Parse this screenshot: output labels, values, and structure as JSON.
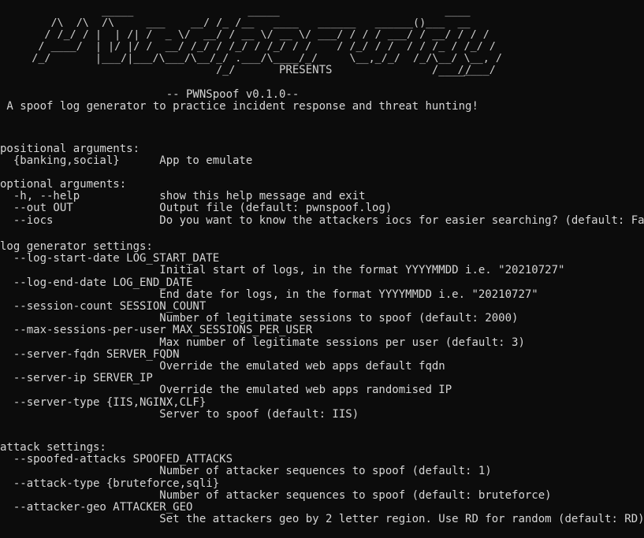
{
  "terminal": {
    "background_color": "#0c0c0c",
    "text_color": "#d6d6d6",
    "banner_color": "#cfcfcf"
  },
  "banner": {
    "name": "pwnsecurity-ascii-art-banner",
    "art": "                _____                  _____                          ____\n        /\\  /\\  /\\     ___    __/ /_ /__   ____   ______   ______()___  __\n       / /_/ / |  | /| /  _ \\/  __/ / __ \\/ __ \\/ ___/ / / / ___/ / __/ / / /\n      / ____/  | |/ |/ /  __/ /_/ / /_/ / /_/ / /    / /_/ / /  / / /_ / /_/ /\n     /_/       |___/|___/\\___/\\__/_/ .___/\\____/_/     \\__,_/_/  /_/\\__/ \\__, /\n                                  /_/                                   /____/",
    "presents_label": "PRESENTS",
    "presents_tail": "/____/"
  },
  "intro": {
    "version_line": "-- PWNSpoof v0.1.0--",
    "description": "A spoof log generator to practice incident response and threat hunting!"
  },
  "sections": {
    "positional": {
      "heading": "positional arguments:",
      "entries": [
        {
          "flag": "{banking,social}",
          "help": "App to emulate",
          "inline": true
        }
      ]
    },
    "optional": {
      "heading": "optional arguments:",
      "entries": [
        {
          "flag": "-h, --help",
          "help": "show this help message and exit",
          "inline": true
        },
        {
          "flag": "--out OUT",
          "help": "Output file (default: pwnspoof.log)",
          "inline": true
        },
        {
          "flag": "--iocs",
          "help": "Do you want to know the attackers iocs for easier searching? (default: False)",
          "inline": true
        }
      ]
    },
    "log_generator": {
      "heading": "log generator settings:",
      "entries": [
        {
          "flag": "--log-start-date LOG_START_DATE",
          "help": "Initial start of logs, in the format YYYYMMDD i.e. \"20210727\"",
          "inline": false
        },
        {
          "flag": "--log-end-date LOG_END_DATE",
          "help": "End date for logs, in the format YYYYMMDD i.e. \"20210727\"",
          "inline": false
        },
        {
          "flag": "--session-count SESSION_COUNT",
          "help": "Number of legitimate sessions to spoof (default: 2000)",
          "inline": false
        },
        {
          "flag": "--max-sessions-per-user MAX_SESSIONS_PER_USER",
          "help": "Max number of legitimate sessions per user (default: 3)",
          "inline": false
        },
        {
          "flag": "--server-fqdn SERVER_FQDN",
          "help": "Override the emulated web apps default fqdn",
          "inline": false
        },
        {
          "flag": "--server-ip SERVER_IP",
          "help": "Override the emulated web apps randomised IP",
          "inline": false
        },
        {
          "flag": "--server-type {IIS,NGINX,CLF}",
          "help": "Server to spoof (default: IIS)",
          "inline": false
        }
      ]
    },
    "attack": {
      "heading": "attack settings:",
      "entries": [
        {
          "flag": "--spoofed-attacks SPOOFED_ATTACKS",
          "help": "Number of attacker sequences to spoof (default: 1)",
          "inline": false
        },
        {
          "flag": "--attack-type {bruteforce,sqli}",
          "help": "Number of attacker sequences to spoof (default: bruteforce)",
          "inline": false
        },
        {
          "flag": "--attacker-geo ATTACKER_GEO",
          "help": "Set the attackers geo by 2 letter region. Use RD for random (default: RD)",
          "inline": false
        }
      ]
    }
  }
}
